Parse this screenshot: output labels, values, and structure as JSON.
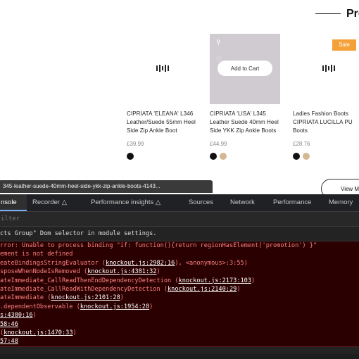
{
  "shop": {
    "section_title": "Pro",
    "products": [
      {
        "name": "CIPRIATA 'ELEANA' L346 Leather/Suede 55mm Heel Side Zip Ankle Boot",
        "price": "£39.99",
        "swatches": [
          "#111111"
        ]
      },
      {
        "name": "CIPRIATA 'LISA' L345 Leather Suede 40mm Heel Side YKK Zip Ankle Boots",
        "price": "£44.99",
        "swatches": [
          "#111111",
          "#d4b894"
        ],
        "add_to_cart": "Add to Cart"
      },
      {
        "name": "Ladies Fashion Boots CIPRIATA LUCILLA PU Boots",
        "price": "£28.76",
        "swatches": [
          "#111111",
          "#d4b894"
        ],
        "badge": "Sale"
      }
    ],
    "status_url": "345-leather-suede-40mm-heel-side-ykk-zip-ankle-boots-4143...",
    "view_more": "View M"
  },
  "devtools": {
    "tabs": [
      "nsole",
      "Recorder",
      "Performance insights",
      "Sources",
      "Network",
      "Performance",
      "Memory"
    ],
    "filter_placeholder": "ilter",
    "messages": {
      "warning": "cts Group\" Dom selector in module settings.",
      "error_lines": [
        {
          "text": "rror: Unable to process binding \"if: function(){return regionHasElement('promotion') }\""
        },
        {
          "text": "ement is not defined"
        },
        {
          "text": "eateBindingsStringEvaluator (",
          "link": "knockout.js:2982:16",
          "after": "), <anonymous>:3:55)"
        },
        {
          "text": "sposeWhenNodeIsRemoved (",
          "link": "knockout.js:4381:32",
          "after": ")"
        },
        {
          "text": "ateImmediate_CallReadThenEndDependencyDetection (",
          "link": "knockout.js:2173:103",
          "after": ")"
        },
        {
          "text": "ateImmediate_CallReadWithDependencyDetection (",
          "link": "knockout.js:2140:29",
          "after": ")"
        },
        {
          "text": "ateImmediate (",
          "link": "knockout.js:2101:28",
          "after": ")"
        },
        {
          "text": ".dependentObservable (",
          "link": "knockout.js:1954:28",
          "after": ")"
        },
        {
          "text": "",
          "link": "s:4380:16",
          "after": ")"
        },
        {
          "text": "",
          "link": "58:46",
          "after": ""
        },
        {
          "text": "(",
          "link": "knockout.js:1470:33",
          "after": ")"
        },
        {
          "text": "",
          "link": "57:48",
          "after": ""
        }
      ]
    }
  }
}
